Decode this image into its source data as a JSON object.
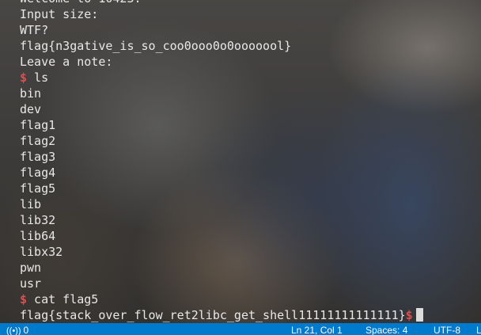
{
  "terminal": {
    "lines": [
      {
        "prompt": "",
        "text": "Welcome to 10423."
      },
      {
        "prompt": "",
        "text": "Input size:"
      },
      {
        "prompt": "",
        "text": "WTF?"
      },
      {
        "prompt": "",
        "text": "flag{n3gative_is_so_coo0ooo0o0ooooool}"
      },
      {
        "prompt": "",
        "text": "Leave a note:"
      },
      {
        "prompt": "$",
        "text": " ls"
      },
      {
        "prompt": "",
        "text": "bin"
      },
      {
        "prompt": "",
        "text": "dev"
      },
      {
        "prompt": "",
        "text": "flag1"
      },
      {
        "prompt": "",
        "text": "flag2"
      },
      {
        "prompt": "",
        "text": "flag3"
      },
      {
        "prompt": "",
        "text": "flag4"
      },
      {
        "prompt": "",
        "text": "flag5"
      },
      {
        "prompt": "",
        "text": "lib"
      },
      {
        "prompt": "",
        "text": "lib32"
      },
      {
        "prompt": "",
        "text": "lib64"
      },
      {
        "prompt": "",
        "text": "libx32"
      },
      {
        "prompt": "",
        "text": "pwn"
      },
      {
        "prompt": "",
        "text": "usr"
      },
      {
        "prompt": "$",
        "text": " cat flag5"
      }
    ],
    "last_line": {
      "text": "flag{stack_over_flow_ret2libc_get_shell11111111111111}",
      "prompt": "$"
    }
  },
  "statusbar": {
    "ports_icon": "broadcast-icon",
    "ports_count": "0",
    "cursor_position": "Ln 21, Col 1",
    "indentation": "Spaces: 4",
    "encoding": "UTF-8",
    "eol": "L"
  },
  "colors": {
    "prompt": "#e64b4b",
    "text": "#e8e8e8",
    "statusbar": "#007acc"
  }
}
